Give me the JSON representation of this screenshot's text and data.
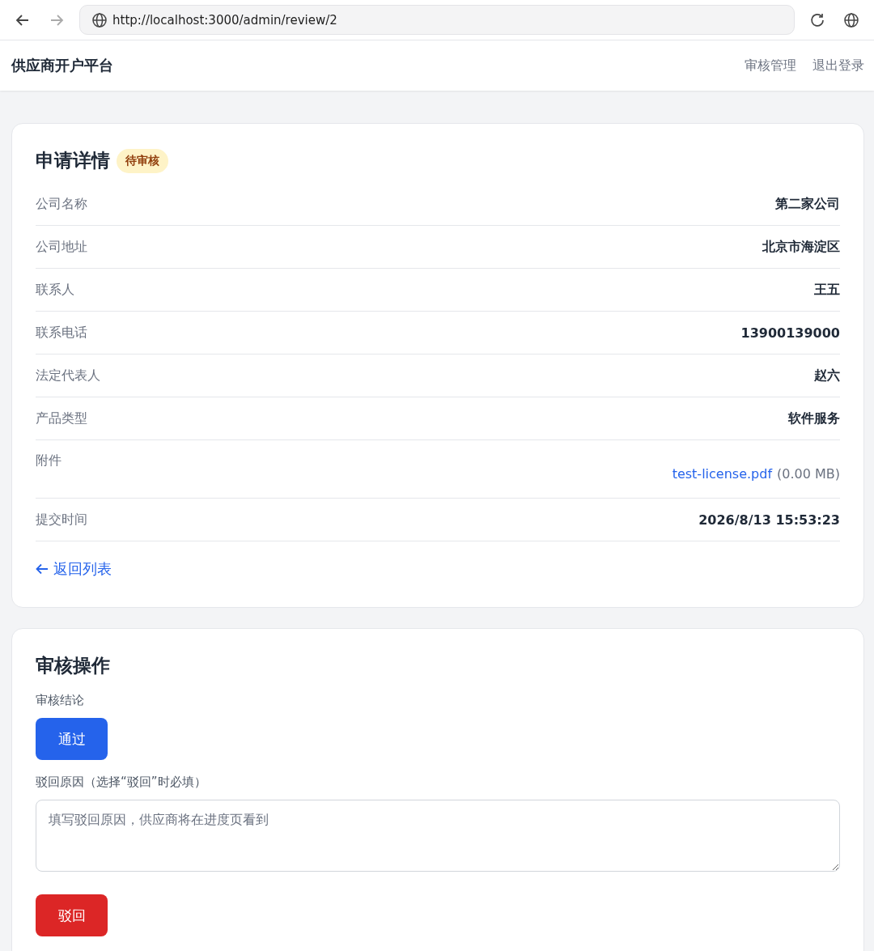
{
  "browser": {
    "url": "http://localhost:3000/admin/review/2"
  },
  "header": {
    "title": "供应商开户平台",
    "links": [
      "审核管理",
      "退出登录"
    ]
  },
  "details": {
    "title": "申请详情",
    "status": "待审核",
    "rows": [
      {
        "kind": "text",
        "label": "公司名称",
        "value": "第二家公司"
      },
      {
        "kind": "text",
        "label": "公司地址",
        "value": "北京市海淀区"
      },
      {
        "kind": "text",
        "label": "联系人",
        "value": "王五"
      },
      {
        "kind": "text",
        "label": "联系电话",
        "value": "13900139000"
      },
      {
        "kind": "text",
        "label": "法定代表人",
        "value": "赵六"
      },
      {
        "kind": "text",
        "label": "产品类型",
        "value": "软件服务"
      },
      {
        "kind": "file",
        "label": "附件",
        "value": "test-license.pdf",
        "size": "(0.00 MB)"
      },
      {
        "kind": "text",
        "label": "提交时间",
        "value": "2026/8/13 15:53:23"
      }
    ],
    "back_link": "返回列表"
  },
  "review": {
    "title": "审核操作",
    "conclusion_label": "审核结论",
    "approve_button": "通过",
    "reason_label": "驳回原因（选择“驳回”时必填）",
    "reason_placeholder": "填写驳回原因，供应商将在进度页看到",
    "reject_button": "驳回"
  }
}
